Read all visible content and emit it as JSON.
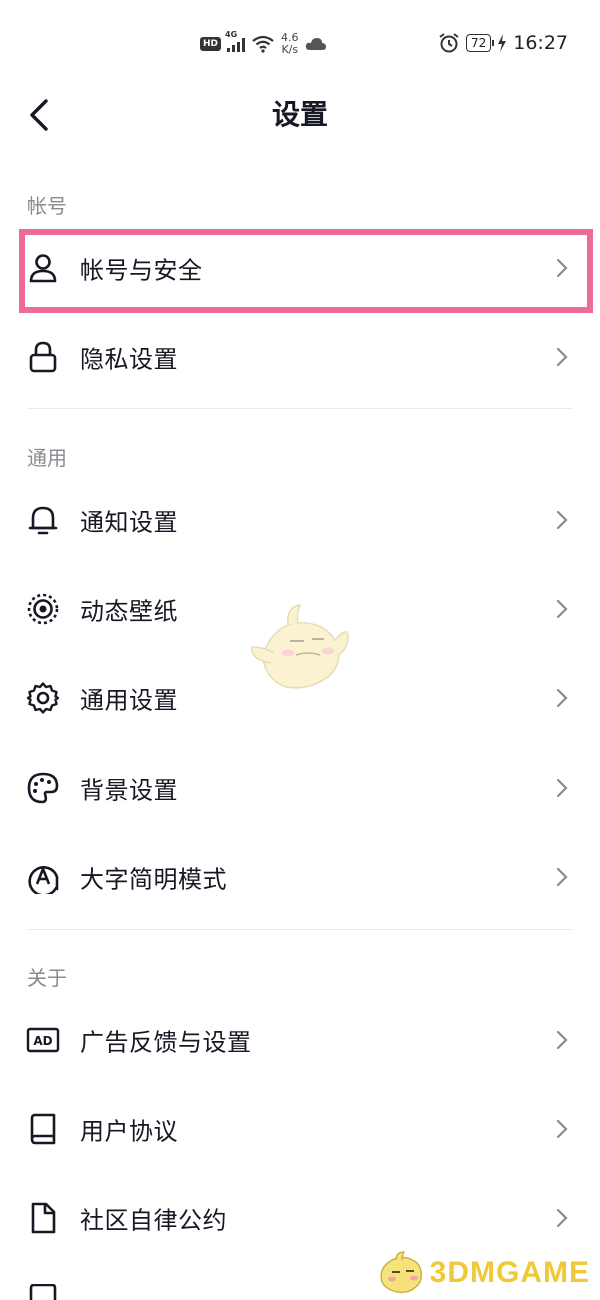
{
  "status_bar": {
    "hd": "HD",
    "network": "4G",
    "speed_value": "4.6",
    "speed_unit": "K/s",
    "battery": "72",
    "time": "16:27",
    "icons": [
      "wifi-icon",
      "cloud-icon",
      "alarm-icon",
      "charging-icon"
    ]
  },
  "header": {
    "title": "设置"
  },
  "sections": [
    {
      "title": "帐号",
      "items": [
        {
          "label": "帐号与安全",
          "icon": "user-icon",
          "highlighted": true
        },
        {
          "label": "隐私设置",
          "icon": "lock-icon"
        }
      ]
    },
    {
      "title": "通用",
      "items": [
        {
          "label": "通知设置",
          "icon": "bell-icon"
        },
        {
          "label": "动态壁纸",
          "icon": "wallpaper-icon"
        },
        {
          "label": "通用设置",
          "icon": "gear-icon"
        },
        {
          "label": "背景设置",
          "icon": "palette-icon"
        },
        {
          "label": "大字简明模式",
          "icon": "large-text-icon"
        }
      ]
    },
    {
      "title": "关于",
      "items": [
        {
          "label": "广告反馈与设置",
          "icon": "ad-icon",
          "icon_text": "AD"
        },
        {
          "label": "用户协议",
          "icon": "book-icon"
        },
        {
          "label": "社区自律公约",
          "icon": "document-icon"
        }
      ]
    }
  ],
  "watermark": {
    "text": "3DMGAME"
  },
  "colors": {
    "highlight": "#ee6b93",
    "text": "#161823",
    "section_title": "#8a8b91",
    "watermark": "#f0c93a"
  }
}
